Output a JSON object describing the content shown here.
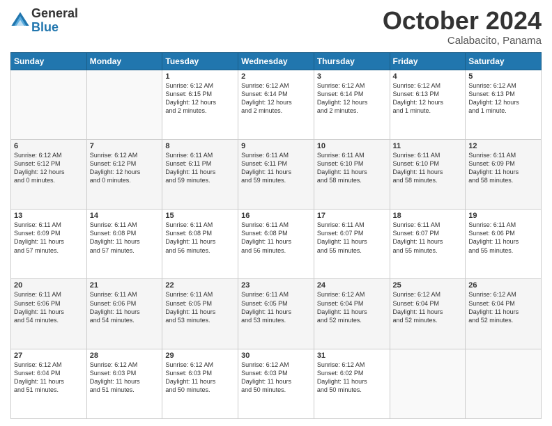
{
  "header": {
    "logo": {
      "general": "General",
      "blue": "Blue"
    },
    "title": "October 2024",
    "location": "Calabacito, Panama"
  },
  "calendar": {
    "days_of_week": [
      "Sunday",
      "Monday",
      "Tuesday",
      "Wednesday",
      "Thursday",
      "Friday",
      "Saturday"
    ],
    "weeks": [
      [
        {
          "day": "",
          "info": ""
        },
        {
          "day": "",
          "info": ""
        },
        {
          "day": "1",
          "info": "Sunrise: 6:12 AM\nSunset: 6:15 PM\nDaylight: 12 hours\nand 2 minutes."
        },
        {
          "day": "2",
          "info": "Sunrise: 6:12 AM\nSunset: 6:14 PM\nDaylight: 12 hours\nand 2 minutes."
        },
        {
          "day": "3",
          "info": "Sunrise: 6:12 AM\nSunset: 6:14 PM\nDaylight: 12 hours\nand 2 minutes."
        },
        {
          "day": "4",
          "info": "Sunrise: 6:12 AM\nSunset: 6:13 PM\nDaylight: 12 hours\nand 1 minute."
        },
        {
          "day": "5",
          "info": "Sunrise: 6:12 AM\nSunset: 6:13 PM\nDaylight: 12 hours\nand 1 minute."
        }
      ],
      [
        {
          "day": "6",
          "info": "Sunrise: 6:12 AM\nSunset: 6:12 PM\nDaylight: 12 hours\nand 0 minutes."
        },
        {
          "day": "7",
          "info": "Sunrise: 6:12 AM\nSunset: 6:12 PM\nDaylight: 12 hours\nand 0 minutes."
        },
        {
          "day": "8",
          "info": "Sunrise: 6:11 AM\nSunset: 6:11 PM\nDaylight: 11 hours\nand 59 minutes."
        },
        {
          "day": "9",
          "info": "Sunrise: 6:11 AM\nSunset: 6:11 PM\nDaylight: 11 hours\nand 59 minutes."
        },
        {
          "day": "10",
          "info": "Sunrise: 6:11 AM\nSunset: 6:10 PM\nDaylight: 11 hours\nand 58 minutes."
        },
        {
          "day": "11",
          "info": "Sunrise: 6:11 AM\nSunset: 6:10 PM\nDaylight: 11 hours\nand 58 minutes."
        },
        {
          "day": "12",
          "info": "Sunrise: 6:11 AM\nSunset: 6:09 PM\nDaylight: 11 hours\nand 58 minutes."
        }
      ],
      [
        {
          "day": "13",
          "info": "Sunrise: 6:11 AM\nSunset: 6:09 PM\nDaylight: 11 hours\nand 57 minutes."
        },
        {
          "day": "14",
          "info": "Sunrise: 6:11 AM\nSunset: 6:08 PM\nDaylight: 11 hours\nand 57 minutes."
        },
        {
          "day": "15",
          "info": "Sunrise: 6:11 AM\nSunset: 6:08 PM\nDaylight: 11 hours\nand 56 minutes."
        },
        {
          "day": "16",
          "info": "Sunrise: 6:11 AM\nSunset: 6:08 PM\nDaylight: 11 hours\nand 56 minutes."
        },
        {
          "day": "17",
          "info": "Sunrise: 6:11 AM\nSunset: 6:07 PM\nDaylight: 11 hours\nand 55 minutes."
        },
        {
          "day": "18",
          "info": "Sunrise: 6:11 AM\nSunset: 6:07 PM\nDaylight: 11 hours\nand 55 minutes."
        },
        {
          "day": "19",
          "info": "Sunrise: 6:11 AM\nSunset: 6:06 PM\nDaylight: 11 hours\nand 55 minutes."
        }
      ],
      [
        {
          "day": "20",
          "info": "Sunrise: 6:11 AM\nSunset: 6:06 PM\nDaylight: 11 hours\nand 54 minutes."
        },
        {
          "day": "21",
          "info": "Sunrise: 6:11 AM\nSunset: 6:06 PM\nDaylight: 11 hours\nand 54 minutes."
        },
        {
          "day": "22",
          "info": "Sunrise: 6:11 AM\nSunset: 6:05 PM\nDaylight: 11 hours\nand 53 minutes."
        },
        {
          "day": "23",
          "info": "Sunrise: 6:11 AM\nSunset: 6:05 PM\nDaylight: 11 hours\nand 53 minutes."
        },
        {
          "day": "24",
          "info": "Sunrise: 6:12 AM\nSunset: 6:04 PM\nDaylight: 11 hours\nand 52 minutes."
        },
        {
          "day": "25",
          "info": "Sunrise: 6:12 AM\nSunset: 6:04 PM\nDaylight: 11 hours\nand 52 minutes."
        },
        {
          "day": "26",
          "info": "Sunrise: 6:12 AM\nSunset: 6:04 PM\nDaylight: 11 hours\nand 52 minutes."
        }
      ],
      [
        {
          "day": "27",
          "info": "Sunrise: 6:12 AM\nSunset: 6:04 PM\nDaylight: 11 hours\nand 51 minutes."
        },
        {
          "day": "28",
          "info": "Sunrise: 6:12 AM\nSunset: 6:03 PM\nDaylight: 11 hours\nand 51 minutes."
        },
        {
          "day": "29",
          "info": "Sunrise: 6:12 AM\nSunset: 6:03 PM\nDaylight: 11 hours\nand 50 minutes."
        },
        {
          "day": "30",
          "info": "Sunrise: 6:12 AM\nSunset: 6:03 PM\nDaylight: 11 hours\nand 50 minutes."
        },
        {
          "day": "31",
          "info": "Sunrise: 6:12 AM\nSunset: 6:02 PM\nDaylight: 11 hours\nand 50 minutes."
        },
        {
          "day": "",
          "info": ""
        },
        {
          "day": "",
          "info": ""
        }
      ]
    ]
  }
}
